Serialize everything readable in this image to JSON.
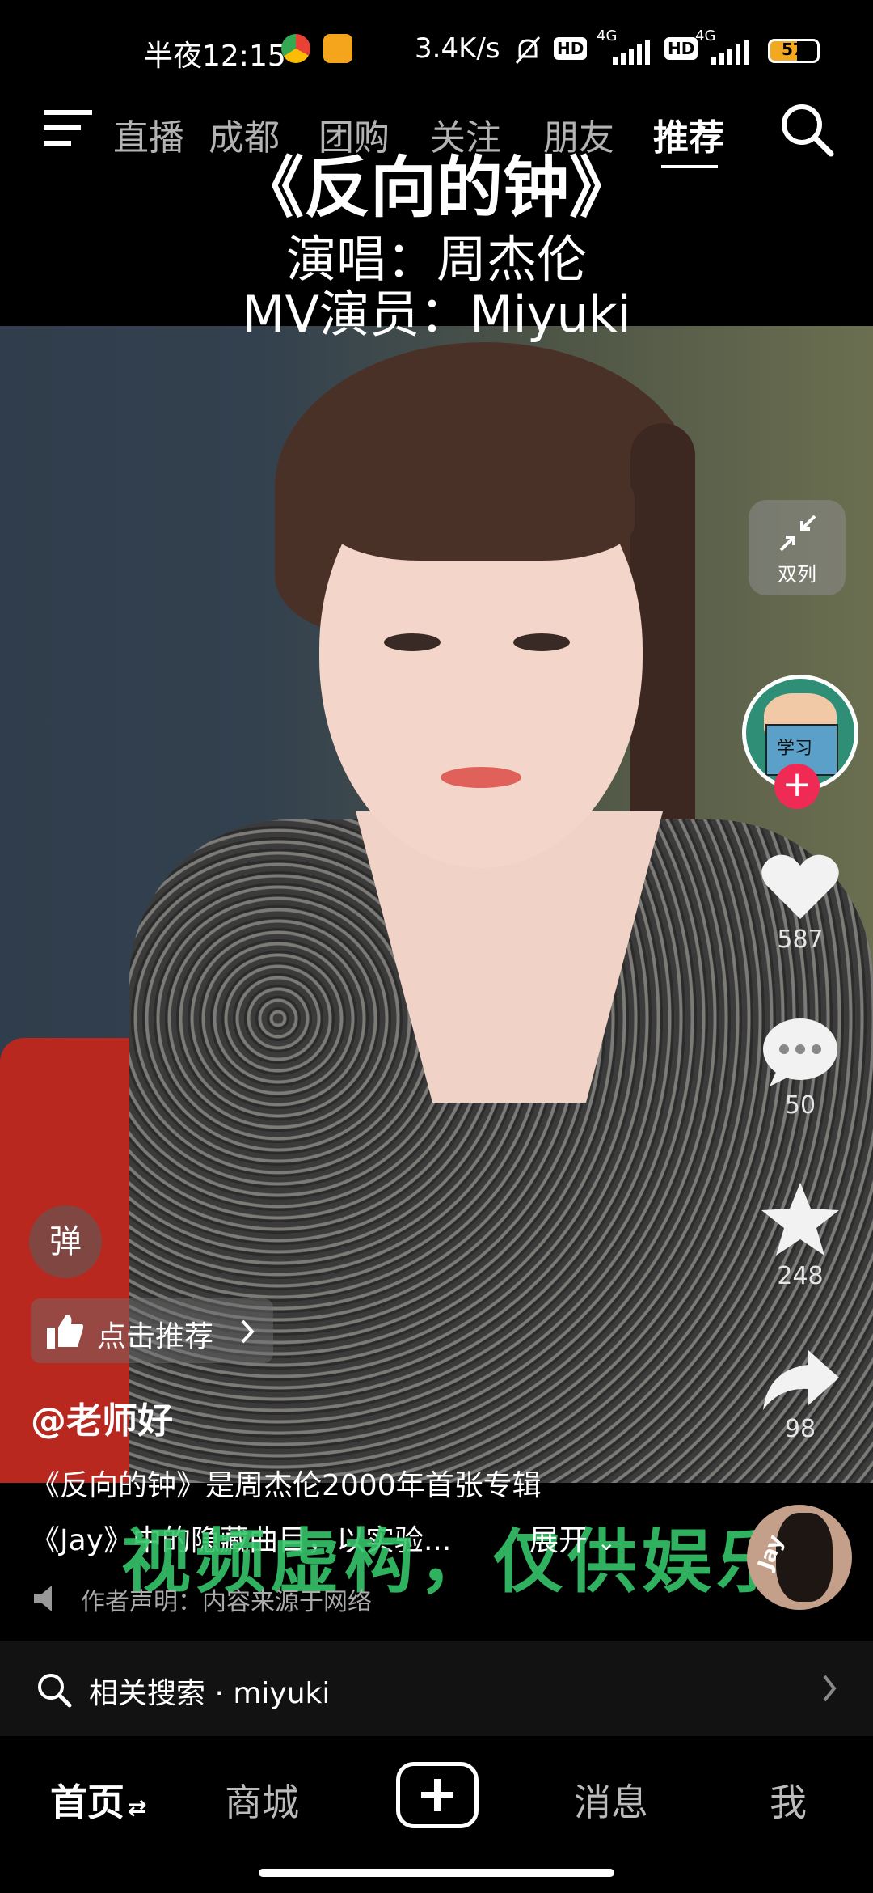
{
  "status_bar": {
    "time": "半夜12:15",
    "network_speed": "3.4K/s",
    "signal_1": "4G",
    "signal_2": "4G",
    "hd_1": "HD",
    "hd_2": "HD",
    "battery": "57"
  },
  "top_nav": {
    "tabs": [
      "直播",
      "成都",
      "团购",
      "关注",
      "朋友",
      "推荐"
    ],
    "active_tab": "推荐"
  },
  "video_overlay": {
    "title": "《反向的钟》",
    "singer_line": "演唱：周杰伦",
    "actor_line": "MV演员：Miyuki",
    "watermark": "视频虚构，仅供娱乐"
  },
  "right_rail": {
    "dual_label": "双列",
    "follow_symbol": "+",
    "likes": "587",
    "comments": "50",
    "favorites": "248",
    "shares": "98",
    "avatar_text": "学习"
  },
  "post": {
    "danmu_label": "弹",
    "recommend_label": "点击推荐",
    "author": "@老师好",
    "desc_line1": "《反向的钟》是周杰伦2000年首张专辑",
    "desc_line2": "《Jay》中的隐藏曲目，以实验...",
    "expand_label": "展开",
    "declaration": "作者声明：内容来源于网络",
    "disc_text": "Jay"
  },
  "related_search": {
    "label": "相关搜索 · miyuki"
  },
  "bottom_tabs": {
    "home": "首页",
    "mall": "商城",
    "messages": "消息",
    "me": "我"
  },
  "colors": {
    "accent_red": "#ee2a55",
    "watermark_green": "#35c56a",
    "background": "#000000"
  }
}
